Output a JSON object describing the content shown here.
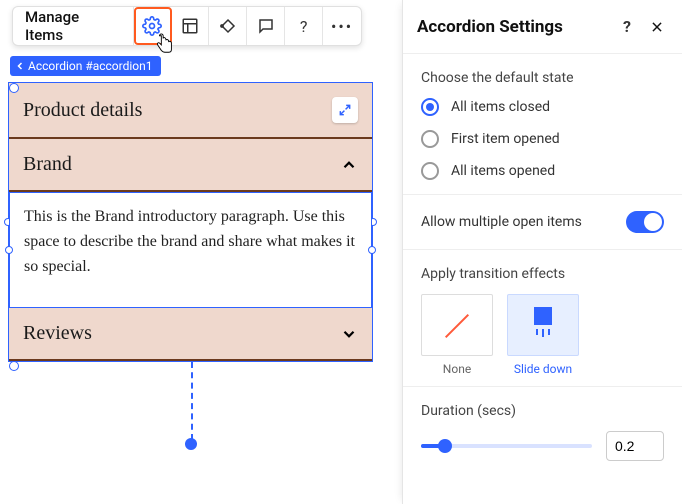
{
  "toolbar": {
    "manage_label": "Manage Items"
  },
  "breadcrumb": {
    "label": "Accordion #accordion1"
  },
  "accordion": {
    "items": [
      {
        "title": "Product details",
        "state": "collapsed"
      },
      {
        "title": "Brand",
        "state": "expanded",
        "body": "This is the Brand introductory paragraph. Use this space to describe the brand and share what makes it so special."
      },
      {
        "title": "Reviews",
        "state": "collapsed"
      }
    ]
  },
  "panel": {
    "title": "Accordion Settings",
    "default_state": {
      "label": "Choose the default state",
      "options": [
        {
          "label": "All items closed",
          "checked": true
        },
        {
          "label": "First item opened",
          "checked": false
        },
        {
          "label": "All items opened",
          "checked": false
        }
      ]
    },
    "allow_multi_label": "Allow multiple open items",
    "allow_multi_on": true,
    "transition": {
      "label": "Apply transition effects",
      "options": [
        {
          "label": "None",
          "selected": false
        },
        {
          "label": "Slide down",
          "selected": true
        }
      ]
    },
    "duration": {
      "label": "Duration (secs)",
      "value": "0.2"
    }
  }
}
